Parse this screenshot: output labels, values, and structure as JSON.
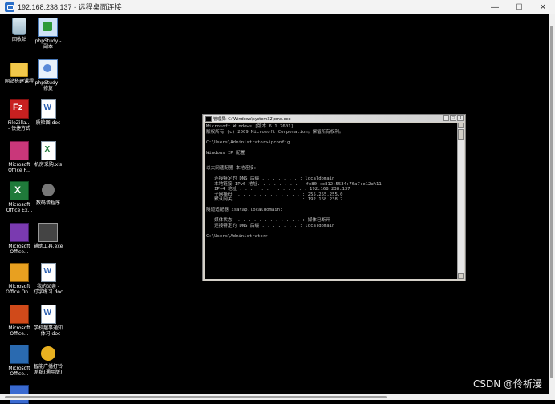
{
  "window": {
    "title": "192.168.238.137 - 远程桌面连接",
    "buttons": [
      "—",
      "☐",
      "✕"
    ]
  },
  "desktop": {
    "icons": [
      {
        "label": "回收站",
        "icon": "recycle-bin-icon"
      },
      {
        "label": "phpStudy -\n副本",
        "icon": "phpstudy-icon"
      },
      {
        "label": "网站搭建课程",
        "icon": "folder-icon"
      },
      {
        "label": "phpStudy -\n修复",
        "icon": "phpstudy-repair-icon"
      },
      {
        "label": "FileZilla...\n- 快捷方式",
        "icon": "filezilla-icon"
      },
      {
        "label": "质检图.doc",
        "icon": "word-doc-icon"
      },
      {
        "label": "Microsoft\nOffice P...",
        "icon": "publisher-icon"
      },
      {
        "label": "机房采购.xls",
        "icon": "excel-file-icon"
      },
      {
        "label": "Microsoft\nOffice Ex...",
        "icon": "excel-icon"
      },
      {
        "label": "数码增程序",
        "icon": "gear-icon"
      },
      {
        "label": "Microsoft\nOffice...",
        "icon": "infopath-icon"
      },
      {
        "label": "辅助工具.exe",
        "icon": "tools-icon"
      },
      {
        "label": "Microsoft\nOffice On...",
        "icon": "onenote-icon"
      },
      {
        "label": "我的父亲 -\n打字练习.doc",
        "icon": "word-doc-icon"
      },
      {
        "label": "Microsoft\nOffice...",
        "icon": "powerpoint-icon"
      },
      {
        "label": "学校趣事通知\n一体习.doc",
        "icon": "word-doc-icon"
      },
      {
        "label": "Microsoft\nOffice...",
        "icon": "sharepoint-icon"
      },
      {
        "label": "智能广播打铃\n系统(通用版)",
        "icon": "speaker-icon"
      },
      {
        "label": "",
        "icon": "app-icon"
      }
    ]
  },
  "cmd": {
    "title": "管理员: C:\\Windows\\system32\\cmd.exe",
    "lines": [
      "Microsoft Windows [版本 6.1.7601]",
      "版权所有 (c) 2009 Microsoft Corporation。保留所有权利。",
      "",
      "C:\\Users\\Administrator>ipconfig",
      "",
      "Windows IP 配置",
      "",
      "",
      "以太网适配器 本地连接:",
      "",
      "   连接特定的 DNS 后缀 . . . . . . . : localdomain",
      "   本地链接 IPv6 地址. . . . . . . . : fe80::c812:5534:76a7:e12a%11",
      "   IPv4 地址 . . . . . . . . . . . . : 192.168.238.137",
      "   子网掩码  . . . . . . . . . . . . : 255.255.255.0",
      "   默认网关. . . . . . . . . . . . . : 192.168.238.2",
      "",
      "隧道适配器 isatap.localdomain:",
      "",
      "   媒体状态  . . . . . . . . . . . . : 媒体已断开",
      "   连接特定的 DNS 后缀 . . . . . . . : localdomain",
      "",
      "C:\\Users\\Administrator>"
    ]
  },
  "watermark": "CSDN @伶祈漫"
}
